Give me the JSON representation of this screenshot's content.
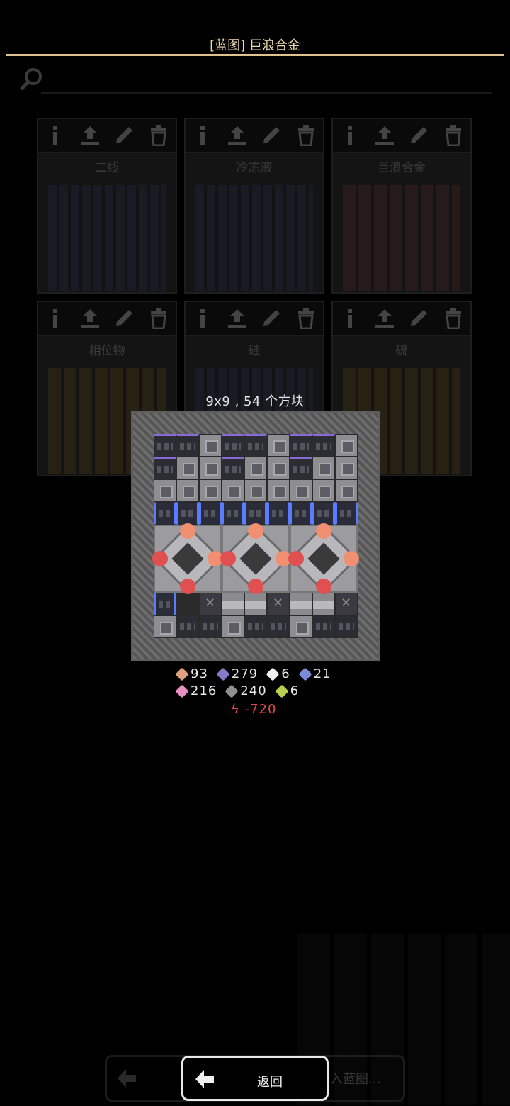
{
  "header": {
    "title": "[蓝图] 巨浪合金"
  },
  "blueprints": [
    {
      "name": "二线"
    },
    {
      "name": "冷冻液"
    },
    {
      "name": "巨浪合金"
    },
    {
      "name": "相位物"
    },
    {
      "name": "硅"
    },
    {
      "name": "硫"
    }
  ],
  "card_icons": [
    "info-icon",
    "upload-icon",
    "edit-icon",
    "trash-icon"
  ],
  "preview": {
    "dimensions": "9x9 , 54 个方块",
    "grid_size": 9
  },
  "cost": {
    "row1": [
      {
        "icon": "copper-ore-icon",
        "color": "#e0a080",
        "value": "93"
      },
      {
        "icon": "purple-ore-icon",
        "color": "#8a78c8",
        "value": "279"
      },
      {
        "icon": "white-gem-icon",
        "color": "#f0f0f0",
        "value": "6"
      },
      {
        "icon": "blue-crystal-icon",
        "color": "#7a8ad8",
        "value": "21"
      }
    ],
    "row2": [
      {
        "icon": "pink-crystal-icon",
        "color": "#e890c0",
        "value": "216"
      },
      {
        "icon": "gray-ore-icon",
        "color": "#909090",
        "value": "240"
      },
      {
        "icon": "green-gem-icon",
        "color": "#b8d050",
        "value": "6"
      }
    ],
    "power": "-720",
    "power_color": "#e04848"
  },
  "footer": {
    "back_label": "返回",
    "import_label": "入蓝图…"
  }
}
